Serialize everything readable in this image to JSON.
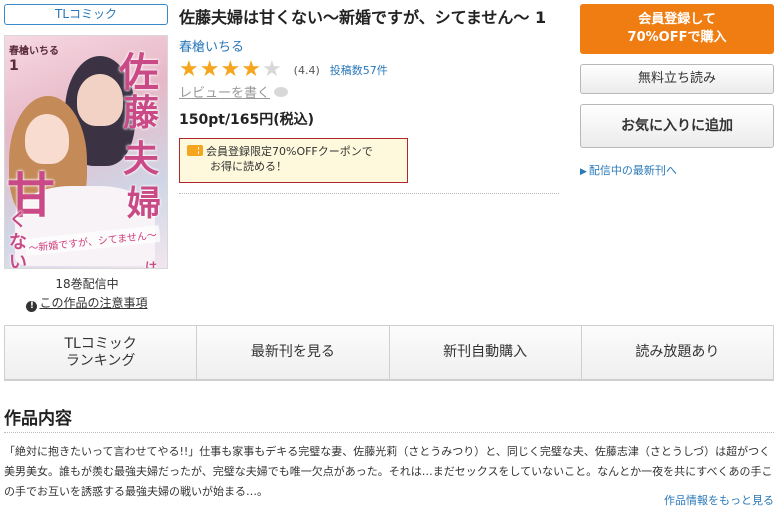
{
  "category": "TLコミック",
  "book": {
    "title": "佐藤夫婦は甘くない～新婚ですが、シてません～ 1",
    "author": "春槍いちる",
    "rating_value": 4.4,
    "rating_text": "(4.4)",
    "star_icons": [
      "star-filled",
      "star-filled",
      "star-filled",
      "star-filled",
      "star-empty"
    ],
    "post_count": "投稿数57件",
    "review_link": "レビューを書く",
    "price": "150pt/165円(税込)"
  },
  "cover": {
    "author": "春槍いちる",
    "volume": "1",
    "title_chars": [
      "佐",
      "藤",
      "夫",
      "婦",
      "甘",
      "く",
      "な",
      "い",
      "は"
    ],
    "subtitle": "～新婚ですが、シてません～"
  },
  "volume_count": "18巻配信中",
  "notice": {
    "icon": "info-icon",
    "label": "この作品の注意事項"
  },
  "coupon": {
    "icon": "coupon-icon",
    "line1": "会員登録限定70%OFFクーポンで",
    "line2": "お得に読める！"
  },
  "buttons": {
    "member_line1": "会員登録して",
    "member_line2": "70%OFFで購入",
    "trial": "無料立ち読み",
    "favorite": "お気に入りに追加"
  },
  "latest_link": "配信中の最新刊へ",
  "tabs": [
    {
      "line1": "TLコミック",
      "line2": "ランキング"
    },
    {
      "line1": "最新刊を見る",
      "line2": ""
    },
    {
      "line1": "新刊自動購入",
      "line2": ""
    },
    {
      "line1": "読み放題あり",
      "line2": ""
    }
  ],
  "section_title": "作品内容",
  "synopsis": "「絶対に抱きたいって言わせてやる!!」仕事も家事もデキる完璧な妻、佐藤光莉（さとうみつり）と、同じく完璧な夫、佐藤志津（さとうしづ）は超がつく美男美女。誰もが羨む最強夫婦だったが、完璧な夫婦でも唯一欠点があった。それは…まだセックスをしていないこと。なんとか一夜を共にすべくあの手この手でお互いを誘惑する最強夫婦の戦いが始まる…。",
  "more_link": "作品情報をもっと見る",
  "colors": {
    "accent_orange": "#f07d12",
    "link_blue": "#2a78b8",
    "star_gold": "#f5a51e",
    "coupon_border": "#b0272c",
    "coupon_bg": "#fef9dc"
  }
}
